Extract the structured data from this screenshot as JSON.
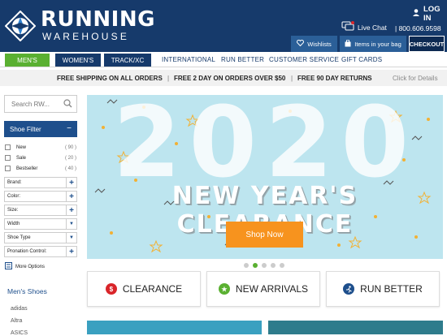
{
  "header": {
    "logo_word": "RUNNING",
    "logo_sub": "WAREHOUSE",
    "login": "LOG IN",
    "live_chat": "Live Chat",
    "phone": "| 800.606.9598",
    "wishlists": "Wishlists",
    "bag": "Items in your bag",
    "checkout": "CHECKOUT"
  },
  "nav": {
    "tabs": [
      "MEN'S",
      "WOMEN'S",
      "TRACK/XC"
    ],
    "links": [
      "INTERNATIONAL",
      "RUN BETTER",
      "CUSTOMER SERVICE",
      "GIFT CARDS"
    ]
  },
  "promo": {
    "items": [
      "FREE SHIPPING ON ALL ORDERS",
      "FREE 2 DAY ON ORDERS OVER $50",
      "FREE 90 DAY RETURNS"
    ],
    "details": "Click for Details"
  },
  "sidebar": {
    "search_placeholder": "Search RW...",
    "filter_title": "Shoe Filter",
    "checks": [
      {
        "label": "New",
        "count": "( 90 )"
      },
      {
        "label": "Sale",
        "count": "( 20 )"
      },
      {
        "label": "Bestseller",
        "count": "( 40 )"
      }
    ],
    "facets": [
      "Brand:",
      "Color:",
      "Size:",
      "Width",
      "Shoe Type",
      "Pronation Control:"
    ],
    "more_options": "More Options",
    "mens_shoes": "Men's Shoes",
    "brands": [
      "adidas",
      "Altra",
      "ASICS"
    ]
  },
  "hero": {
    "year": "2020",
    "title": "NEW YEAR'S CLEARANCE",
    "button": "Shop Now"
  },
  "carousel": {
    "count": 5,
    "active": 1
  },
  "quick_links": [
    {
      "label": "CLEARANCE",
      "icon": "dollar-icon",
      "color": "#d9252a"
    },
    {
      "label": "NEW ARRIVALS",
      "icon": "star-icon",
      "color": "#5ab031"
    },
    {
      "label": "RUN BETTER",
      "icon": "runner-icon",
      "color": "#1e4f8c"
    }
  ],
  "colors": {
    "navy": "#163a6b",
    "green": "#5ab031",
    "orange": "#f7931e",
    "sky": "#bde5ef"
  }
}
